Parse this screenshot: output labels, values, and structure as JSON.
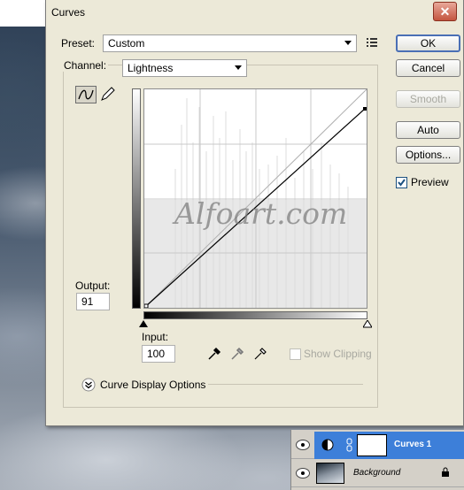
{
  "dialog": {
    "title": "Curves",
    "close_symbol": "✕",
    "preset_label": "Preset:",
    "preset_value": "Custom",
    "channel_label": "Channel:",
    "channel_value": "Lightness",
    "output_label": "Output:",
    "output_value": "91",
    "input_label": "Input:",
    "input_value": "100",
    "show_clipping_label": "Show Clipping",
    "curve_display_options_label": "Curve Display Options",
    "watermark": "Alfoart.com"
  },
  "buttons": {
    "ok": "OK",
    "cancel": "Cancel",
    "smooth": "Smooth",
    "auto": "Auto",
    "options": "Options...",
    "preview_label": "Preview"
  },
  "state": {
    "preview_checked": true,
    "show_clipping_checked": false,
    "smooth_enabled": false
  },
  "layers": [
    {
      "name": "Curves 1",
      "selected": true
    },
    {
      "name": "Background",
      "selected": false,
      "locked": true
    }
  ],
  "icons": {
    "close": "close-icon",
    "preset_options": "preset-options-icon",
    "curve_tool": "curve-tool-icon",
    "pencil_tool": "pencil-icon",
    "black_eyedropper": "black-eyedropper-icon",
    "gray_eyedropper": "gray-eyedropper-icon",
    "white_eyedropper": "white-eyedropper-icon",
    "expand": "chevron-down-icon",
    "eye": "eye-icon",
    "lock": "lock-icon"
  },
  "colors": {
    "dialog_bg": "#ece9d8",
    "default_button_border": "#4a6fb5",
    "layer_selected": "#3d7fd9"
  }
}
